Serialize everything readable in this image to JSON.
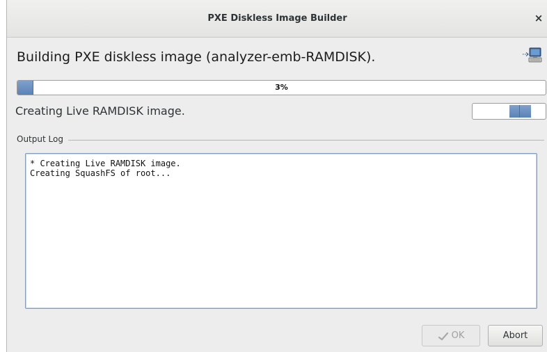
{
  "window": {
    "title": "PXE Diskless Image Builder",
    "close_label": "×"
  },
  "heading": "Building PXE diskless image (analyzer-emb-RAMDISK).",
  "progress": {
    "value": 0.03,
    "text": "3%"
  },
  "status_text": "Creating Live RAMDISK image.",
  "output_log": {
    "label": "Output Log",
    "lines": [
      "* Creating Live RAMDISK image.",
      "Creating SquashFS of root..."
    ]
  },
  "buttons": {
    "ok_label": "OK",
    "abort_label": "Abort"
  },
  "icons": {
    "heading_icon": "network-computer-icon",
    "ok_icon": "ok-check-icon"
  },
  "colors": {
    "accent": "#5a83b6",
    "log_border": "#7f9fc0"
  }
}
